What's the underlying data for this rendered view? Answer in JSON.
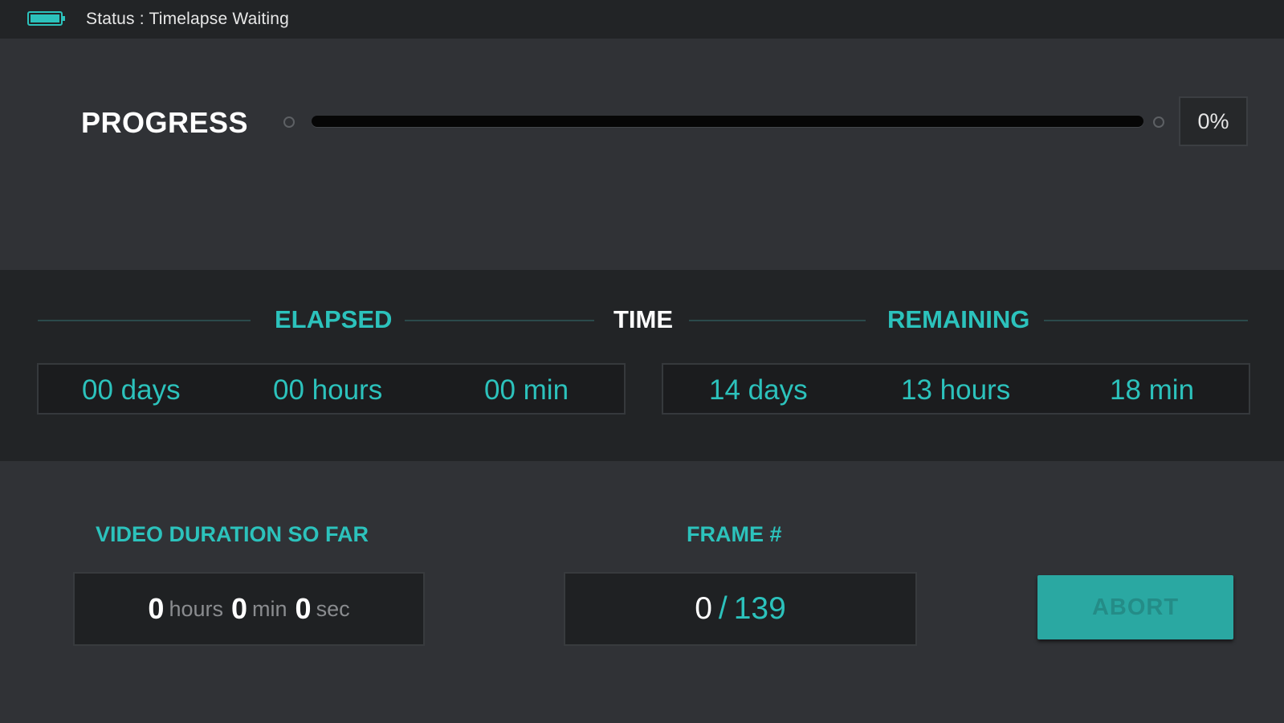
{
  "status_bar": {
    "text": "Status : Timelapse Waiting",
    "battery_icon": "battery-full-icon",
    "battery_color": "#2cc2bc"
  },
  "progress": {
    "label": "PROGRESS",
    "value_fraction": 0.0,
    "percent_text": "0%"
  },
  "time": {
    "elapsed_heading": "ELAPSED",
    "center_heading": "TIME",
    "remaining_heading": "REMAINING",
    "elapsed": {
      "days": "00 days",
      "hours": "00 hours",
      "minutes": "00 min"
    },
    "remaining": {
      "days": "14 days",
      "hours": "13 hours",
      "minutes": "18 min"
    }
  },
  "video_duration": {
    "label": "VIDEO DURATION SO FAR",
    "hours": "0",
    "hours_unit": "hours",
    "minutes": "0",
    "minutes_unit": "min",
    "seconds": "0",
    "seconds_unit": "sec"
  },
  "frame": {
    "label": "FRAME #",
    "current": "0",
    "separator": "/",
    "total": "139"
  },
  "abort_button": {
    "label": "ABORT"
  },
  "colors": {
    "accent": "#2cc2bc",
    "button": "#2aa8a2",
    "background": "#303236",
    "panel_dark": "#222426"
  }
}
